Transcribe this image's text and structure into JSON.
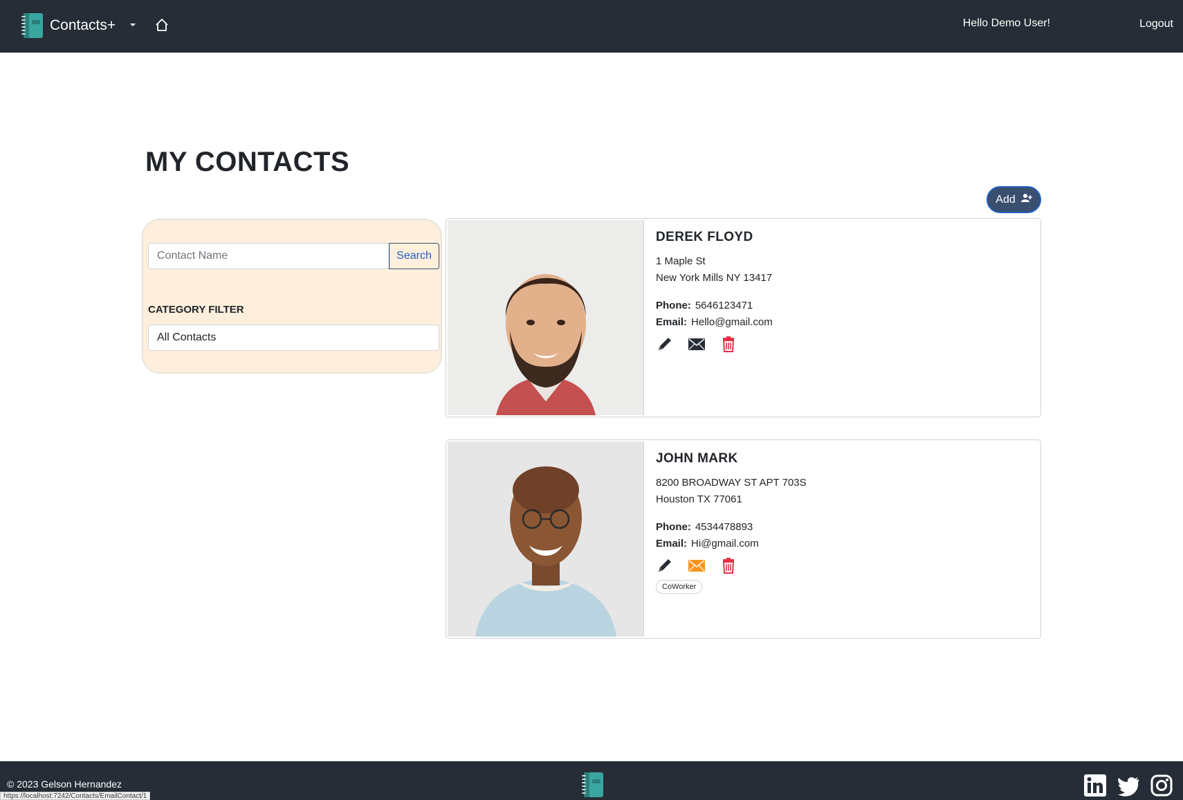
{
  "nav": {
    "brand": "Contacts+",
    "greeting": "Hello Demo User!",
    "logout": "Logout"
  },
  "page": {
    "title": "MY CONTACTS",
    "add_label": "Add"
  },
  "sidebar": {
    "search_placeholder": "Contact Name",
    "search_button": "Search",
    "category_label": "CATEGORY FILTER",
    "category_selected": "All Contacts"
  },
  "contacts": [
    {
      "name": "DEREK FLOYD",
      "address1": "1 Maple St",
      "address2": "New York Mills NY 13417",
      "phone_label": "Phone:",
      "phone": "5646123471",
      "email_label": "Email:",
      "email": "Hello@gmail.com",
      "email_icon_color": "#262d36",
      "tags": []
    },
    {
      "name": "JOHN MARK",
      "address1": "8200 BROADWAY ST APT 703S",
      "address2": "Houston TX 77061",
      "phone_label": "Phone:",
      "phone": "4534478893",
      "email_label": "Email:",
      "email": "Hi@gmail.com",
      "email_icon_color": "#f7941d",
      "tags": [
        "CoWorker"
      ]
    }
  ],
  "footer": {
    "copyright": "© 2023 Gelson Hernandez",
    "status_url": "https://localhost:7242/Contacts/EmailContact/1"
  },
  "colors": {
    "navbar": "#262d36",
    "panel": "#feefdc",
    "delete": "#dc3545",
    "accent": "#1f5fbf"
  }
}
